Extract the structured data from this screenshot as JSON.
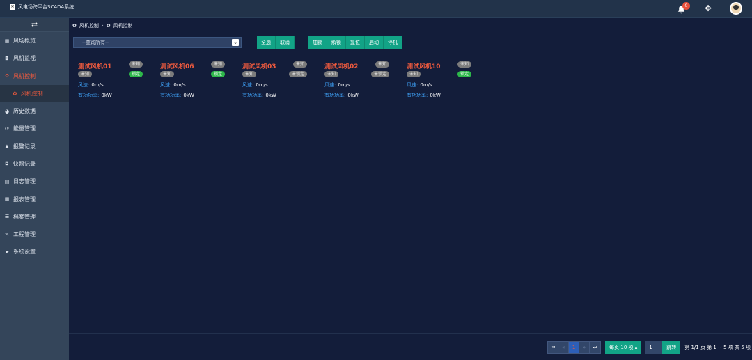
{
  "app": {
    "title": "风电场跨平台SCADA系统"
  },
  "header": {
    "notification_count": "0"
  },
  "sidebar": {
    "toggle": "⇄",
    "items": [
      {
        "label": "风场概览",
        "icon": "grid-icon",
        "glyph": "▦"
      },
      {
        "label": "风机监视",
        "icon": "camera-icon",
        "glyph": "◘"
      },
      {
        "label": "风机控制",
        "icon": "gear-icon",
        "glyph": "✿"
      },
      {
        "label": "历史数据",
        "icon": "pie-icon",
        "glyph": "◕"
      },
      {
        "label": "能量管理",
        "icon": "sync-icon",
        "glyph": "⟳"
      },
      {
        "label": "报警记录",
        "icon": "bell-icon",
        "glyph": "▲"
      },
      {
        "label": "快照记录",
        "icon": "camera-icon",
        "glyph": "◘"
      },
      {
        "label": "日志管理",
        "icon": "file-icon",
        "glyph": "▤"
      },
      {
        "label": "报表管理",
        "icon": "table-icon",
        "glyph": "▦"
      },
      {
        "label": "档案管理",
        "icon": "list-icon",
        "glyph": "☰"
      },
      {
        "label": "工程管理",
        "icon": "wrench-icon",
        "glyph": "✎"
      },
      {
        "label": "系统设置",
        "icon": "send-icon",
        "glyph": "➤"
      }
    ],
    "active_sub": "风机控制"
  },
  "breadcrumb": {
    "parent": "风机控制",
    "separator": "›",
    "current": "风机控制"
  },
  "toolbar": {
    "select_value": "--查询所有--",
    "select_all": "全选",
    "cancel": "取消",
    "lock": "加锁",
    "unlock": "解锁",
    "reset": "复位",
    "start": "启动",
    "stop": "停机"
  },
  "turbines": [
    {
      "name": "测试风机01",
      "status1": "未知",
      "status2": "未知",
      "status3": "锁定",
      "wind_label": "风速:",
      "wind": "0m/s",
      "power_label": "有功功率:",
      "power": "0kW"
    },
    {
      "name": "测试风机06",
      "status1": "未知",
      "status2": "未知",
      "status3": "锁定",
      "wind_label": "风速:",
      "wind": "0m/s",
      "power_label": "有功功率:",
      "power": "0kW"
    },
    {
      "name": "测试风机03",
      "status1": "未知",
      "status2": "未知",
      "status3": "未锁定",
      "wind_label": "风速:",
      "wind": "0m/s",
      "power_label": "有功功率:",
      "power": "0kW"
    },
    {
      "name": "测试风机02",
      "status1": "未知",
      "status2": "未知",
      "status3": "未锁定",
      "wind_label": "风速:",
      "wind": "0m/s",
      "power_label": "有功功率:",
      "power": "0kW"
    },
    {
      "name": "测试风机10",
      "status1": "未知",
      "status2": "未知",
      "status3": "锁定",
      "wind_label": "风速:",
      "wind": "0m/s",
      "power_label": "有功功率:",
      "power": "0kW"
    }
  ],
  "pagination": {
    "first": "⏮",
    "prev": "«",
    "current": "1",
    "next": "»",
    "last": "⏭",
    "per_page": "每页 10 项 ▴",
    "jump_value": "1",
    "jump_label": "跳转",
    "page_info": "第 1/1 页  第 1 ~ 5 项  共 5 项"
  },
  "colors": {
    "accent": "#ee5a3e",
    "button": "#12a386",
    "locked": "#2db84a",
    "unknown": "#7c7c7c"
  }
}
